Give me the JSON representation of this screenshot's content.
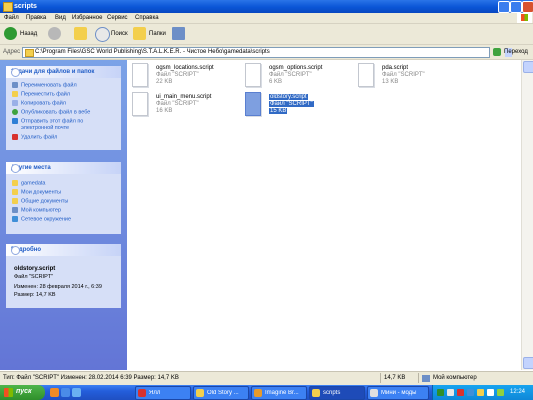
{
  "window": {
    "title": "scripts"
  },
  "menu": [
    "Файл",
    "Правка",
    "Вид",
    "Избранное",
    "Сервис",
    "Справка"
  ],
  "toolbar": {
    "back_label": "Назад",
    "search_label": "Поиск",
    "folders_label": "Папки"
  },
  "address": {
    "label": "Адрес",
    "path": "C:\\Program Files\\GSC World Publishing\\S.T.A.L.K.E.R. - Чистое Небо\\gamedata\\scripts",
    "go_label": "Переход"
  },
  "tasks_panel": {
    "title": "Задачи для файлов и папок",
    "items": [
      "Переименовать файл",
      "Переместить файл",
      "Копировать файл",
      "Опубликовать файл в вебе",
      "Отправить этот файл по",
      "электронной почте",
      "Удалить файл"
    ]
  },
  "places_panel": {
    "title": "Другие места",
    "items": [
      "gamedata",
      "Мои документы",
      "Общие документы",
      "Мой компьютер",
      "Сетевое окружение"
    ]
  },
  "details_panel": {
    "title": "Подробно",
    "filename": "oldstory.script",
    "filetype": "Файл \"SCRIPT\"",
    "modified": "Изменен: 28 февраля 2014 г., 6:39",
    "size": "Размер: 14,7 KB"
  },
  "files": [
    {
      "name": "ogsm_locations.script",
      "type": "Файл \"SCRIPT\"",
      "size": "22 KB"
    },
    {
      "name": "ogsm_options.script",
      "type": "Файл \"SCRIPT\"",
      "size": "6 KB"
    },
    {
      "name": "pda.script",
      "type": "Файл \"SCRIPT\"",
      "size": "13 KB"
    },
    {
      "name": "ui_main_menu.script",
      "type": "Файл \"SCRIPT\"",
      "size": "16 KB"
    },
    {
      "name": "oldstory.script",
      "type": "Файл \"SCRIPT\"",
      "size": "15 KB"
    }
  ],
  "status": {
    "info": "Тип: Файл \"SCRIPT\" Изменен: 28.02.2014 6:39 Размер: 14,7 KB",
    "size": "14,7 KB",
    "location": "Мой компьютер"
  },
  "taskbar": {
    "start_label": "пуск",
    "buttons": [
      "Ялл",
      "Old Story ...",
      "Imagine Br...",
      "scripts",
      "Мини - моды"
    ],
    "clock": "12:24"
  },
  "colors": {
    "titlebar": "#0a55d6",
    "selection": "#316ac5",
    "taskpane": "#6375d6",
    "start": "#2f8f2b"
  }
}
